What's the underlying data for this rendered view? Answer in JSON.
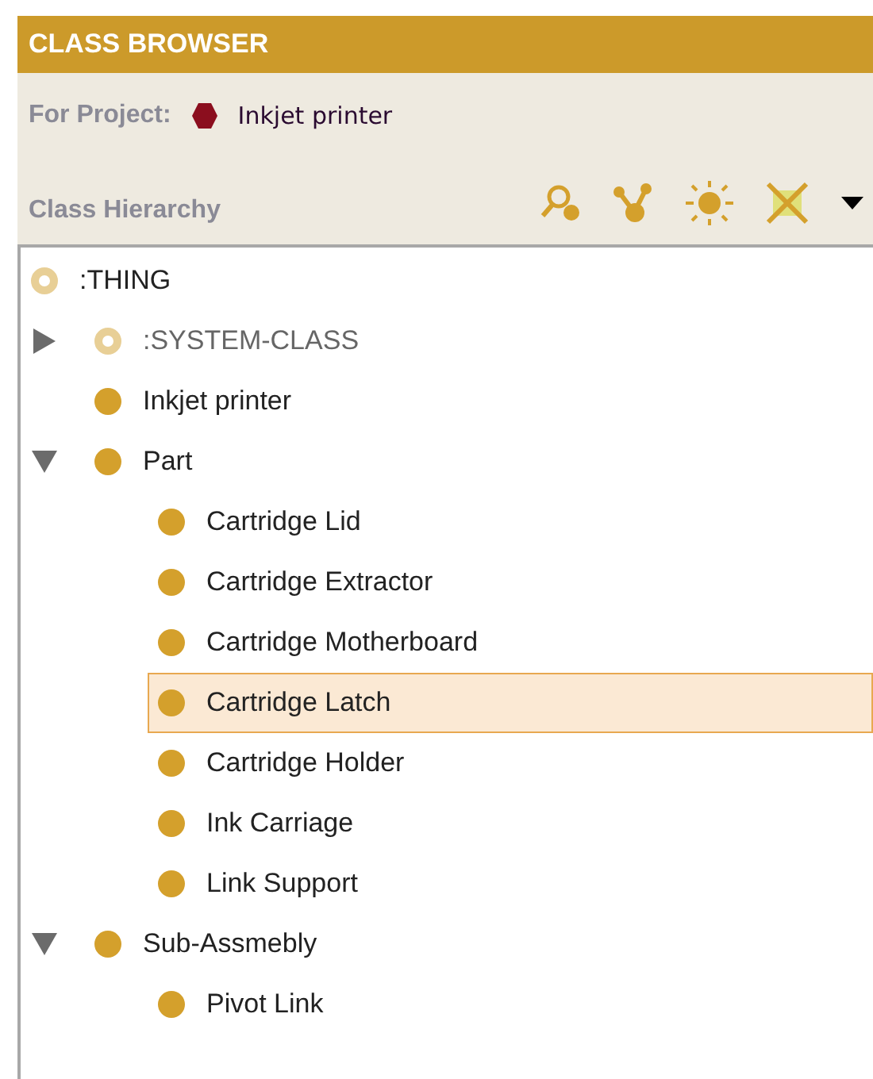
{
  "panel": {
    "title": "CLASS BROWSER",
    "project_label": "For Project:",
    "project_name": "Inkjet printer",
    "hierarchy_label": "Class Hierarchy"
  },
  "tree": [
    {
      "label": ":THING",
      "kind": "system",
      "selected": false,
      "children": [
        {
          "label": ":SYSTEM-CLASS",
          "kind": "system",
          "expanded": false,
          "selected": false
        },
        {
          "label": "Inkjet printer",
          "kind": "class",
          "selected": false
        },
        {
          "label": "Part",
          "kind": "class",
          "expanded": true,
          "selected": false,
          "children": [
            {
              "label": "Cartridge Lid",
              "kind": "class",
              "selected": false
            },
            {
              "label": "Cartridge Extractor",
              "kind": "class",
              "selected": false
            },
            {
              "label": "Cartridge Motherboard",
              "kind": "class",
              "selected": false
            },
            {
              "label": "Cartridge Latch",
              "kind": "class",
              "selected": true
            },
            {
              "label": "Cartridge Holder",
              "kind": "class",
              "selected": false
            },
            {
              "label": "Ink Carriage",
              "kind": "class",
              "selected": false
            },
            {
              "label": "Link Support",
              "kind": "class",
              "selected": false
            }
          ]
        },
        {
          "label": "Sub-Assmebly",
          "kind": "class",
          "expanded": true,
          "selected": false,
          "children": [
            {
              "label": "Pivot Link",
              "kind": "class",
              "selected": false
            }
          ]
        }
      ]
    }
  ]
}
